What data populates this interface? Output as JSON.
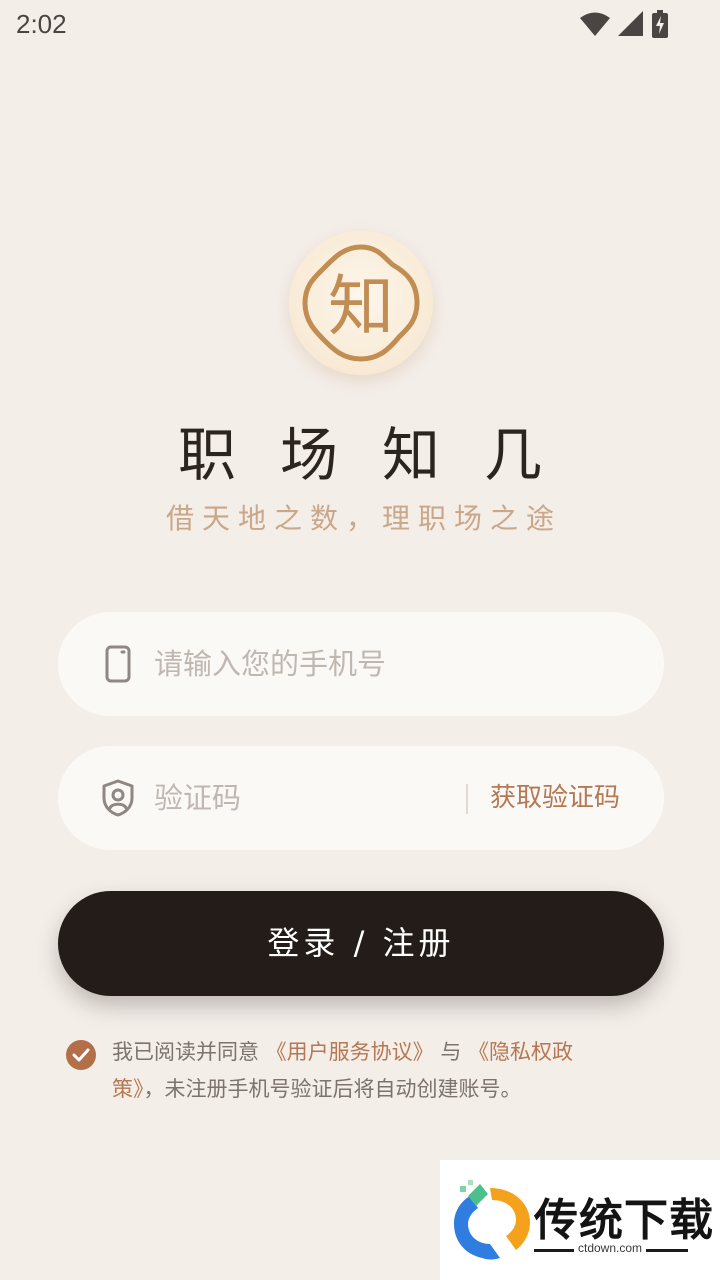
{
  "status_bar": {
    "time": "2:02",
    "icons": [
      "wifi-icon",
      "signal-icon",
      "battery-charging-icon"
    ]
  },
  "logo": {
    "glyph": "知",
    "color": "#c28d53"
  },
  "app": {
    "title": "职场知几",
    "subtitle": "借天地之数，理职场之途"
  },
  "phone_field": {
    "icon": "phone-icon",
    "placeholder": "请输入您的手机号",
    "value": ""
  },
  "code_field": {
    "icon": "shield-user-icon",
    "placeholder": "验证码",
    "value": "",
    "get_code_label": "获取验证码"
  },
  "login_button": {
    "label": "登录 / 注册"
  },
  "agreement": {
    "checked": true,
    "prefix": "我已阅读并同意",
    "terms_link": "《用户服务协议》",
    "connector": "与",
    "privacy_link": "《隐私权政策》",
    "suffix": "，未注册手机号验证后将自动创建账号。"
  },
  "watermark": {
    "text": "传统下载",
    "domain": "ctdown.com"
  },
  "colors": {
    "background": "#f4eee9",
    "accent": "#b57852",
    "button": "#231c19",
    "subtitle": "#c9a788"
  }
}
